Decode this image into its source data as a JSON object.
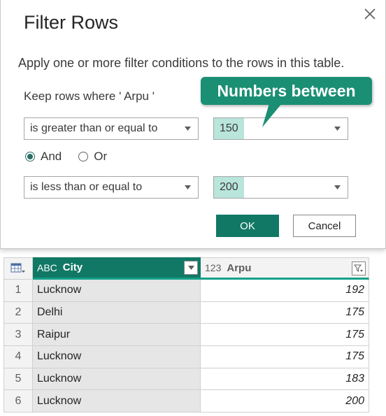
{
  "dialog": {
    "title": "Filter Rows",
    "description": "Apply one or more filter conditions to the rows in this table.",
    "keep_label": "Keep rows where ' Arpu '",
    "condition1": {
      "operator": "is greater than or equal to",
      "value": "150"
    },
    "logic": {
      "and_label": "And",
      "or_label": "Or",
      "selected": "And"
    },
    "condition2": {
      "operator": "is less than or equal to",
      "value": "200"
    },
    "ok_label": "OK",
    "cancel_label": "Cancel"
  },
  "callout": {
    "text": "Numbers between"
  },
  "table": {
    "columns": [
      {
        "type_icon": "ABC",
        "name": "City"
      },
      {
        "type_icon": "123",
        "name": "Arpu"
      }
    ],
    "rows": [
      {
        "n": "1",
        "city": "Lucknow",
        "arpu": "192"
      },
      {
        "n": "2",
        "city": "Delhi",
        "arpu": "175"
      },
      {
        "n": "3",
        "city": "Raipur",
        "arpu": "175"
      },
      {
        "n": "4",
        "city": "Lucknow",
        "arpu": "175"
      },
      {
        "n": "5",
        "city": "Lucknow",
        "arpu": "183"
      },
      {
        "n": "6",
        "city": "Lucknow",
        "arpu": "200"
      }
    ]
  },
  "colors": {
    "accent": "#117865",
    "callout": "#1a8f73",
    "value_highlight": "#b9e5db"
  }
}
